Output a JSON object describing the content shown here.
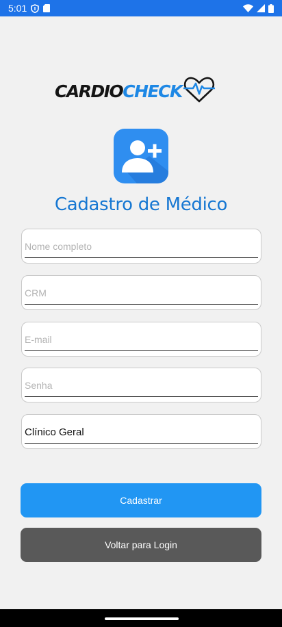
{
  "status_bar": {
    "time": "5:01",
    "icons": [
      "shield-icon",
      "sd-card-icon",
      "wifi-icon",
      "signal-icon",
      "battery-icon"
    ]
  },
  "logo": {
    "part1": "CARDIO",
    "part2": "CHECK",
    "icon": "heart-pulse-icon"
  },
  "page": {
    "icon": "add-user-icon",
    "title": "Cadastro de Médico"
  },
  "form": {
    "name_placeholder": "Nome completo",
    "crm_placeholder": "CRM",
    "email_placeholder": "E-mail",
    "password_placeholder": "Senha",
    "specialty_value": "Clínico Geral"
  },
  "buttons": {
    "register_label": "Cadastrar",
    "back_label": "Voltar para Login"
  },
  "colors": {
    "status_bar": "#1e73e8",
    "brand_blue": "#1e88e5",
    "title_blue": "#1677d2",
    "primary_button": "#2196f3",
    "secondary_button": "#595959",
    "background": "#f1f1f1"
  }
}
